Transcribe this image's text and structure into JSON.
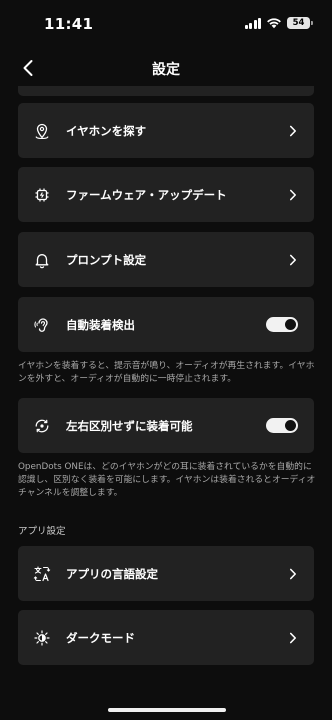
{
  "status": {
    "time": "11:41",
    "battery": "54"
  },
  "nav": {
    "title": "設定"
  },
  "items": {
    "find_earphones": "イヤホンを探す",
    "firmware_update": "ファームウェア・アップデート",
    "prompt_settings": "プロンプト設定",
    "auto_detect": "自動装着検出",
    "lr_free": "左右区別せずに装着可能",
    "app_language": "アプリの言語設定",
    "dark_mode": "ダークモード"
  },
  "toggles": {
    "auto_detect": true,
    "lr_free": true
  },
  "descriptions": {
    "auto_detect": "イヤホンを装着すると、提示音が鳴り、オーディオが再生されます。イヤホンを外すと、オーディオが自動的に一時停止されます。",
    "lr_free": "OpenDots ONEは、どのイヤホンがどの耳に装着されているかを自動的に認識し、区別なく装着を可能にします。イヤホンは装着されるとオーディオチャンネルを調整します。"
  },
  "sections": {
    "app_settings": "アプリ設定"
  },
  "icons": {
    "back": "chevron-left-icon",
    "find": "location-pin-icon",
    "firmware": "chip-icon",
    "prompt": "bell-icon",
    "auto_detect": "ear-icon",
    "lr_free": "rotate-icon",
    "language": "translate-icon",
    "dark": "sun-icon"
  },
  "colors": {
    "background": "#0d0d0d",
    "card": "#222222",
    "description": "#a7a7a7"
  }
}
